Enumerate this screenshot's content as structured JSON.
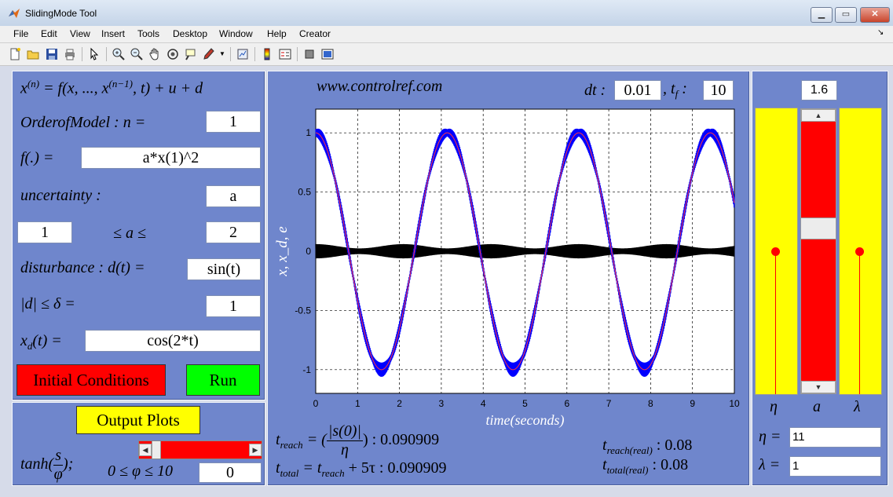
{
  "window": {
    "title": "SlidingMode Tool"
  },
  "menubar": [
    "File",
    "Edit",
    "View",
    "Insert",
    "Tools",
    "Desktop",
    "Window",
    "Help",
    "Creator"
  ],
  "toolbar": [
    "new-file-icon",
    "open-folder-icon",
    "save-icon",
    "print-icon",
    "pointer-icon",
    "zoom-in-icon",
    "zoom-out-icon",
    "pan-hand-icon",
    "rotate-3d-icon",
    "data-cursor-icon",
    "brush-icon",
    "dropdown-arrow-icon",
    "link-plot-icon",
    "colorbar-icon",
    "legend-icon",
    "hide-tools-icon",
    "dock-icon"
  ],
  "left": {
    "equation_lhs": "x",
    "equation_sup": "(n)",
    "equation_rhs": "= f(x, ..., x",
    "equation_sup2": "(n−1)",
    "equation_tail": ", t) + u + d",
    "order_label": "OrderofModel : n =",
    "order_value": "1",
    "f_label": "f(.) =",
    "f_value": "a*x(1)^2",
    "uncertainty_label": "uncertainty :",
    "uncertainty_value": "a",
    "a_min": "1",
    "a_range_label": "≤ a ≤",
    "a_max": "2",
    "disturbance_label": "disturbance : d(t) =",
    "disturbance_value": "sin(t)",
    "delta_label": "|d| ≤ δ =",
    "delta_value": "1",
    "xd_label": "x",
    "xd_sub": "d",
    "xd_tail": "(t) =",
    "xd_value": "cos(2*t)",
    "init_button": "Initial Conditions",
    "run_button": "Run"
  },
  "bottom_left": {
    "output_button": "Output Plots",
    "tanh_label": "tanh(",
    "tanh_num": "s",
    "tanh_den": "φ",
    "tanh_tail": ");",
    "phi_range_label": "0 ≤ φ ≤ 10",
    "phi_value": "0",
    "phi_slider_fraction": 0.0
  },
  "center": {
    "website": "www.controlref.com",
    "dt_label": "dt :",
    "dt_value": "0.01",
    "tf_label": ", t",
    "tf_sub": "f",
    "tf_colon": ":",
    "tf_value": "10",
    "treach_label": "t",
    "treach_sub": "reach",
    "treach_eq": "= (",
    "treach_num": "|s(0)|",
    "treach_den": "η",
    "treach_value": ") : 0.090909",
    "ttotal_label": "t",
    "ttotal_sub": "total",
    "ttotal_eq": "= t",
    "ttotal_sub2": "reach",
    "ttotal_value": "+ 5τ : 0.090909",
    "treach_real_label": "t",
    "treach_real_sub": "reach(real)",
    "treach_real_value": ": 0.08",
    "ttotal_real_label": "t",
    "ttotal_real_sub": "total(real)",
    "ttotal_real_value": ": 0.08"
  },
  "right": {
    "a_display": "1.6",
    "eta_label": "η",
    "a_label": "a",
    "lambda_label": "λ",
    "eta_eq": "η =",
    "eta_value": "11",
    "lambda_eq": "λ =",
    "lambda_value": "1",
    "a_slider_fraction": 0.4,
    "eta_level": 0.5,
    "lambda_level": 0.5
  },
  "colors": {
    "panel": "#6f86cc",
    "red": "#ff0000",
    "green": "#00ff00",
    "yellow": "#ffff00",
    "blue_trace": "#0000ff",
    "desired_trace": "#ff3344",
    "error_trace": "#000000"
  },
  "chart_data": {
    "type": "line",
    "xlabel": "time(seconds)",
    "ylabel": "x, x_d, e",
    "xlim": [
      0,
      10
    ],
    "ylim": [
      -1.2,
      1.2
    ],
    "xticks": [
      0,
      1,
      2,
      3,
      4,
      5,
      6,
      7,
      8,
      9,
      10
    ],
    "yticks": [
      -1,
      -0.5,
      0,
      0.5,
      1
    ],
    "ytick_labels": [
      "-1",
      "-0.5",
      "0",
      "0.5",
      "1"
    ],
    "grid": true,
    "series": [
      {
        "role": "x",
        "color": "#0000ff",
        "formula": "cos(2t) with chattering band",
        "amplitude_noise": 0.06
      },
      {
        "role": "x_d",
        "color": "#ff3344",
        "formula": "cos(2t)"
      },
      {
        "role": "e",
        "color": "#000000",
        "formula": "chattering error around 0",
        "band": 0.06
      }
    ]
  }
}
